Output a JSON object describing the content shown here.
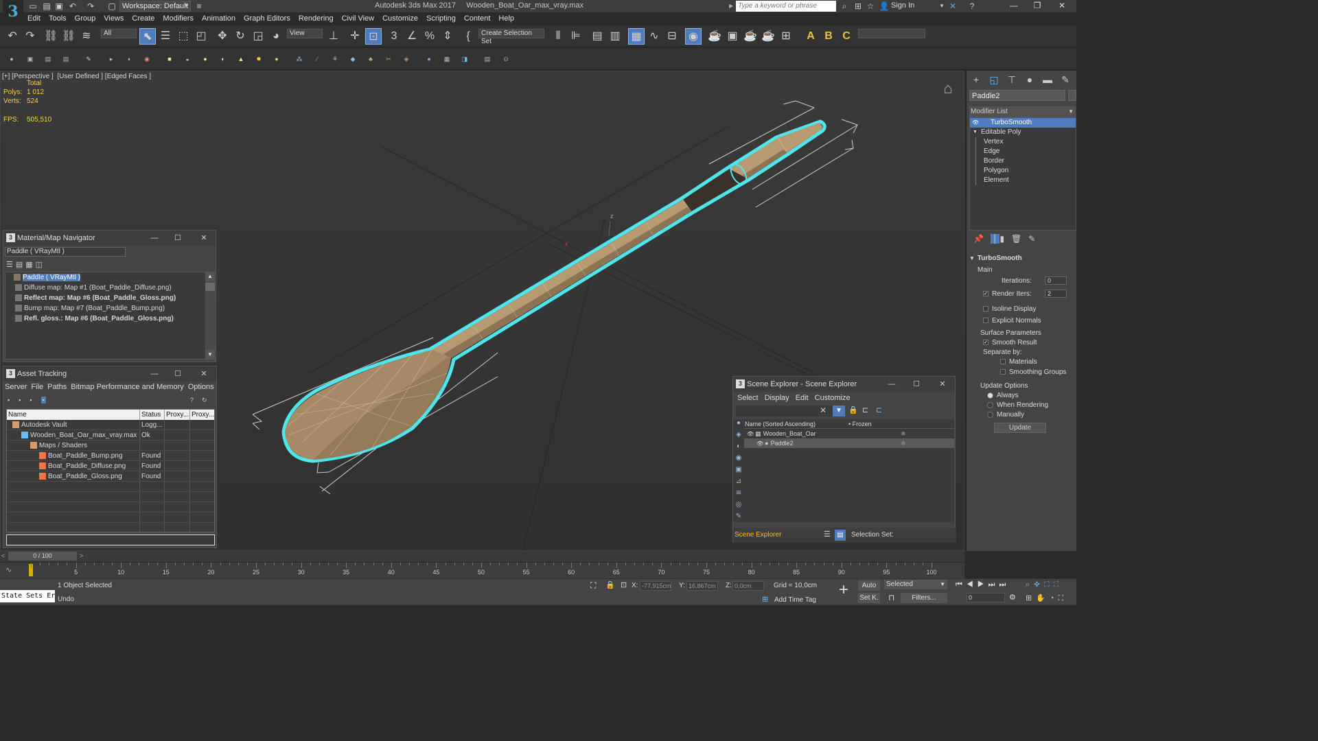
{
  "titlebar": {
    "workspace_label": "Workspace: Default",
    "app_title": "Autodesk 3ds Max 2017     Wooden_Boat_Oar_max_vray.max",
    "search_placeholder": "Type a keyword or phrase",
    "sign_in": "Sign In",
    "app_icon_glyph": "3"
  },
  "menubar": {
    "items": [
      "Edit",
      "Tools",
      "Group",
      "Views",
      "Create",
      "Modifiers",
      "Animation",
      "Graph Editors",
      "Rendering",
      "Civil View",
      "Customize",
      "Scripting",
      "Content",
      "Help"
    ]
  },
  "toolbar": {
    "selection_filter": "All",
    "ref_coord": "View",
    "selection_set": "Create Selection Set"
  },
  "viewport": {
    "label": "[+] [Perspective ]  [User Defined ] [Edged Faces ]",
    "stats_total_label": "Total",
    "polys_label": "Polys:",
    "polys_value": "1 012",
    "verts_label": "Verts:",
    "verts_value": "524",
    "fps_label": "FPS:",
    "fps_value": "505,510",
    "axis_z": "z",
    "axis_x": "x"
  },
  "material_navigator": {
    "title": "Material/Map Navigator",
    "current": "Paddle  ( VRayMtl )",
    "tree": [
      {
        "label": "Paddle  ( VRayMtl )",
        "bold": false,
        "selected": true
      },
      {
        "label": "Diffuse map: Map #1 (Boat_Paddle_Diffuse.png)",
        "bold": false,
        "selected": false
      },
      {
        "label": "Reflect map: Map #6 (Boat_Paddle_Gloss.png)",
        "bold": true,
        "selected": false
      },
      {
        "label": "Bump map: Map #7 (Boat_Paddle_Bump.png)",
        "bold": false,
        "selected": false
      },
      {
        "label": "Refl. gloss.: Map #6 (Boat_Paddle_Gloss.png)",
        "bold": true,
        "selected": false
      }
    ]
  },
  "asset_tracking": {
    "title": "Asset Tracking",
    "menu": [
      "Server",
      "File",
      "Paths",
      "Bitmap Performance and Memory",
      "Options"
    ],
    "columns": [
      "Name",
      "Status",
      "Proxy...",
      "Proxy..."
    ],
    "rows": [
      {
        "name": "Autodesk Vault",
        "status": "Logg...",
        "indent": 0
      },
      {
        "name": "Wooden_Boat_Oar_max_vray.max",
        "status": "Ok",
        "indent": 1
      },
      {
        "name": "Maps / Shaders",
        "status": "",
        "indent": 2
      },
      {
        "name": "Boat_Paddle_Bump.png",
        "status": "Found",
        "indent": 3
      },
      {
        "name": "Boat_Paddle_Diffuse.png",
        "status": "Found",
        "indent": 3
      },
      {
        "name": "Boat_Paddle_Gloss.png",
        "status": "Found",
        "indent": 3
      }
    ]
  },
  "scene_explorer": {
    "title": "Scene Explorer - Scene Explorer",
    "menu": [
      "Select",
      "Display",
      "Edit",
      "Customize"
    ],
    "col_name": "Name (Sorted Ascending)",
    "col_frozen": "• Frozen",
    "rows": [
      {
        "name": "Wooden_Boat_Oar",
        "selected": false,
        "indent": 0
      },
      {
        "name": "Paddle2",
        "selected": true,
        "indent": 1
      }
    ],
    "footer_label": "Scene Explorer",
    "selection_set_label": "Selection Set:"
  },
  "command_panel": {
    "object_name": "Paddle2",
    "modifier_list": "Modifier List",
    "stack": [
      {
        "label": "TurboSmooth",
        "selected": true,
        "level": 0
      },
      {
        "label": "Editable Poly",
        "selected": false,
        "level": 0
      },
      {
        "label": "Vertex",
        "selected": false,
        "level": 1
      },
      {
        "label": "Edge",
        "selected": false,
        "level": 1
      },
      {
        "label": "Border",
        "selected": false,
        "level": 1
      },
      {
        "label": "Polygon",
        "selected": false,
        "level": 1
      },
      {
        "label": "Element",
        "selected": false,
        "level": 1
      }
    ],
    "rollout_title": "TurboSmooth",
    "main_label": "Main",
    "iterations_label": "Iterations:",
    "iterations_value": "0",
    "render_iters_label": "Render Iters:",
    "render_iters_value": "2",
    "isoline_label": "Isoline Display",
    "explicit_normals_label": "Explicit Normals",
    "surface_params_label": "Surface Parameters",
    "smooth_result_label": "Smooth Result",
    "separate_by_label": "Separate by:",
    "materials_label": "Materials",
    "smoothing_groups_label": "Smoothing Groups",
    "update_options_label": "Update Options",
    "always_label": "Always",
    "when_rendering_label": "When Rendering",
    "manually_label": "Manually",
    "update_button": "Update"
  },
  "timeline": {
    "frame_display": "0 / 100",
    "ticks": [
      0,
      5,
      10,
      15,
      20,
      25,
      30,
      35,
      40,
      45,
      50,
      55,
      60,
      65,
      70,
      75,
      80,
      85,
      90,
      95,
      100
    ]
  },
  "statusbar": {
    "maxscript_label": "State Sets Er",
    "objects_selected": "1 Object Selected",
    "undo_label": "Undo",
    "x_label": "X:",
    "x_value": "-77,915cm",
    "y_label": "Y:",
    "y_value": "16,867cm",
    "z_label": "Z:",
    "z_value": "0,0cm",
    "grid_label": "Grid = 10,0cm",
    "add_time_tag": "Add Time Tag",
    "auto_key": "Auto",
    "set_key": "Set K.",
    "selected_dropdown": "Selected",
    "filters_button": "Filters...",
    "frame_value": "0"
  },
  "colors": {
    "selection_blue": "#4f7cbd",
    "outline_cyan": "#4ee6ec",
    "stats_yellow": "#ffd24a",
    "wood": "#b89a72"
  }
}
